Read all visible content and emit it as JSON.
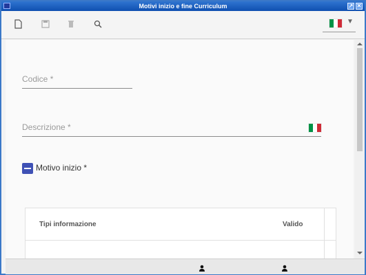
{
  "window": {
    "title": "Motivi inizio e fine Curriculum",
    "maximize_icon": "↗",
    "close_icon": "✕"
  },
  "toolbar": {
    "buttons": [
      {
        "name": "new-document-icon"
      },
      {
        "name": "save-icon"
      },
      {
        "name": "delete-icon"
      },
      {
        "name": "search-icon"
      }
    ],
    "language_flag": "italian-flag-icon",
    "language_dropdown_arrow": "▼"
  },
  "form": {
    "codice_placeholder": "Codice *",
    "descrizione_placeholder": "Descrizione *",
    "motivo_inizio_label": "Motivo inizio *",
    "motivo_inizio_checked": true
  },
  "table": {
    "headers": [
      "Tipi informazione",
      "Valido"
    ]
  },
  "colors": {
    "titlebar": "#1f5fc0",
    "checkbox": "#3f51b5",
    "flag_green": "#009246",
    "flag_white": "#ffffff",
    "flag_red": "#ce2b37"
  }
}
